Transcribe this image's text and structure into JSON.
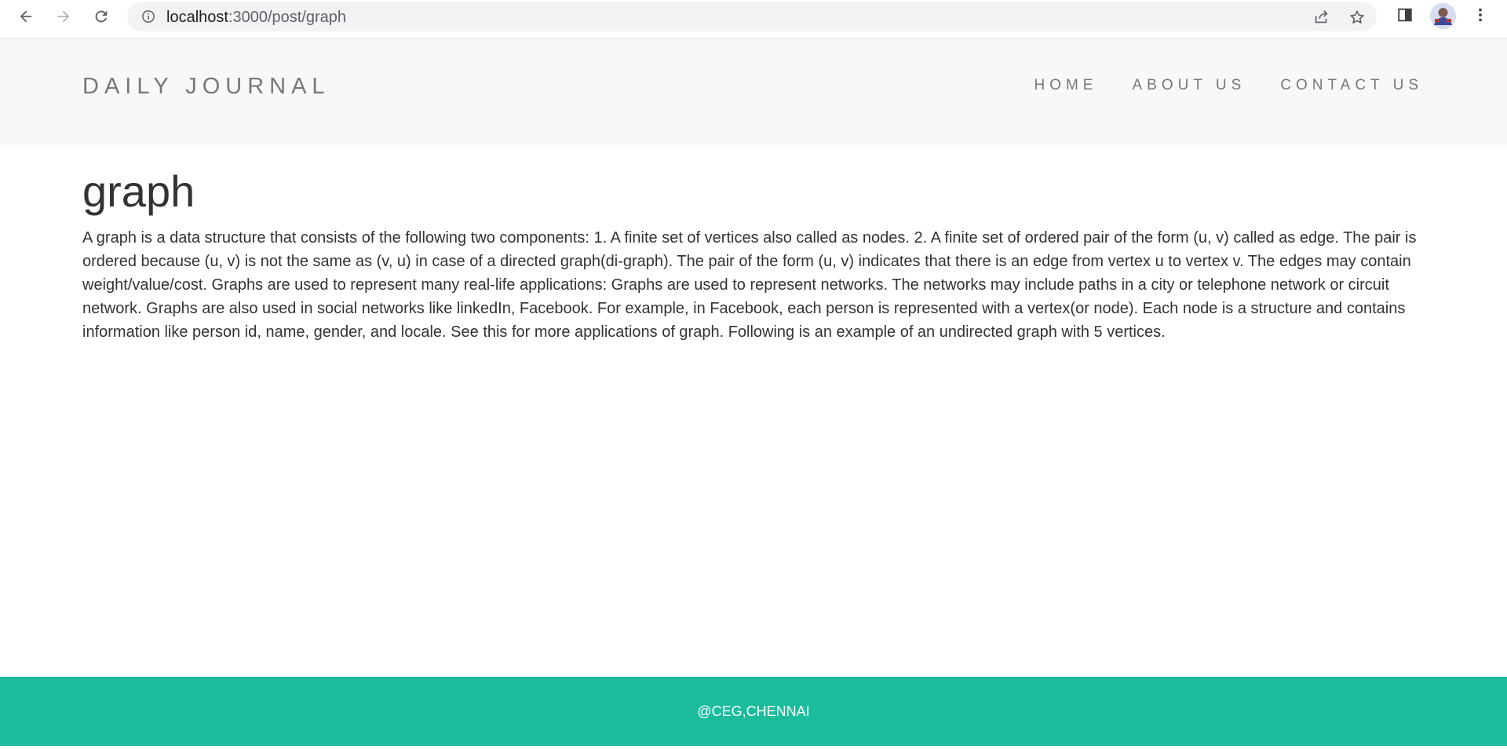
{
  "browser": {
    "url_host": "localhost",
    "url_path": ":3000/post/graph"
  },
  "header": {
    "brand": "DAILY JOURNAL",
    "nav": [
      {
        "label": "HOME"
      },
      {
        "label": "ABOUT US"
      },
      {
        "label": "CONTACT US"
      }
    ]
  },
  "post": {
    "title": "graph",
    "body": "A graph is a data structure that consists of the following two components: 1. A finite set of vertices also called as nodes. 2. A finite set of ordered pair of the form (u, v) called as edge. The pair is ordered because (u, v) is not the same as (v, u) in case of a directed graph(di-graph). The pair of the form (u, v) indicates that there is an edge from vertex u to vertex v. The edges may contain weight/value/cost. Graphs are used to represent many real-life applications: Graphs are used to represent networks. The networks may include paths in a city or telephone network or circuit network. Graphs are also used in social networks like linkedIn, Facebook. For example, in Facebook, each person is represented with a vertex(or node). Each node is a structure and contains information like person id, name, gender, and locale. See this for more applications of graph. Following is an example of an undirected graph with 5 vertices."
  },
  "footer": {
    "text": "@CEG,CHENNAI"
  },
  "colors": {
    "header_bg": "#f8f8f8",
    "footer_bg": "#1abc9c",
    "nav_text": "#777777",
    "body_text": "#333333"
  },
  "icons": [
    "back-arrow-icon",
    "forward-arrow-icon",
    "reload-icon",
    "info-icon",
    "share-icon",
    "star-icon",
    "side-panel-icon",
    "profile-avatar",
    "more-vert-icon"
  ]
}
